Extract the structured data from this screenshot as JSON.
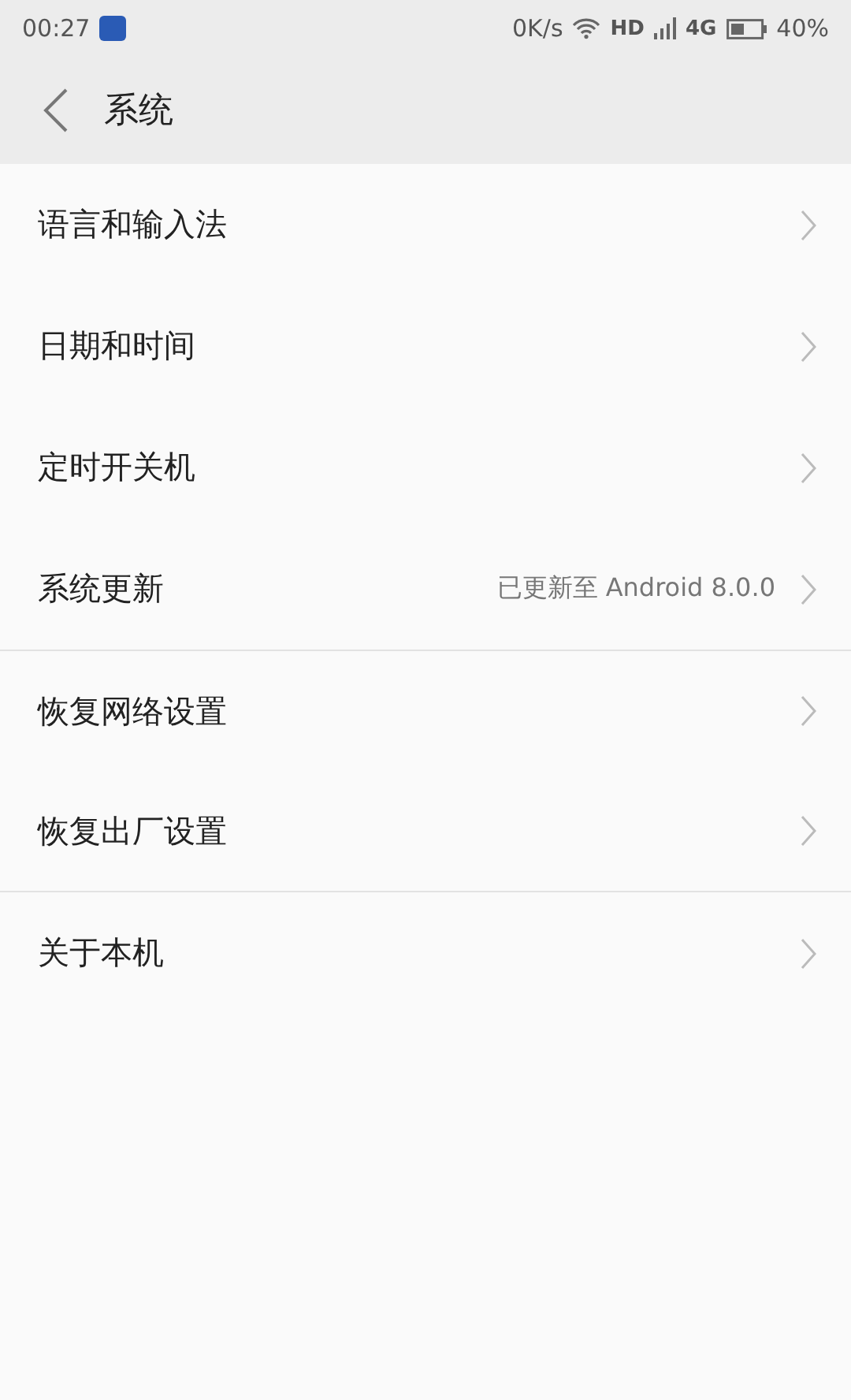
{
  "status_bar": {
    "time": "00:27",
    "speed": "0K/s",
    "hd": "HD",
    "network": "4G",
    "battery": "40%"
  },
  "header": {
    "title": "系统"
  },
  "groups": [
    {
      "items": [
        {
          "label": "语言和输入法"
        },
        {
          "label": "日期和时间"
        },
        {
          "label": "定时开关机"
        },
        {
          "label": "系统更新",
          "value": "已更新至 Android 8.0.0"
        }
      ]
    },
    {
      "items": [
        {
          "label": "恢复网络设置"
        },
        {
          "label": "恢复出厂设置"
        }
      ]
    },
    {
      "items": [
        {
          "label": "关于本机"
        }
      ]
    }
  ]
}
